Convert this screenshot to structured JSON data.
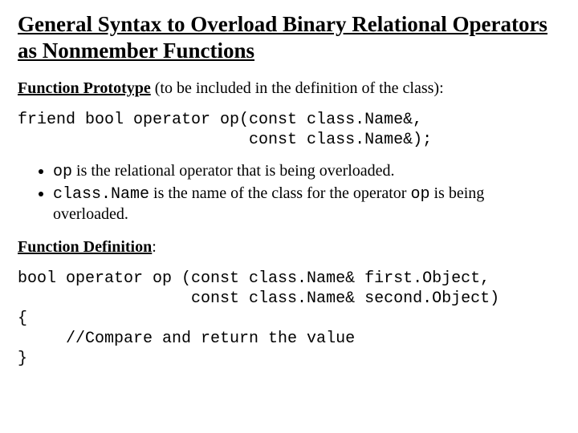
{
  "title": "General Syntax to Overload Binary Relational Operators as Nonmember Functions",
  "proto_label": "Function Prototype",
  "proto_paren": " (to be included in the definition of the class):",
  "proto_code": "friend bool operator op(const class.Name&,\n                        const class.Name&);",
  "bullets": {
    "b1_code": "op",
    "b1_text": " is the relational operator that is being overloaded.",
    "b2_code1": "class.Name",
    "b2_mid": " is the name of the class for the operator ",
    "b2_code2": "op",
    "b2_tail": " is being overloaded."
  },
  "def_label": "Function Definition",
  "def_colon": ":",
  "def_code": "bool operator op (const class.Name& first.Object,\n                  const class.Name& second.Object)\n{\n     //Compare and return the value\n}"
}
